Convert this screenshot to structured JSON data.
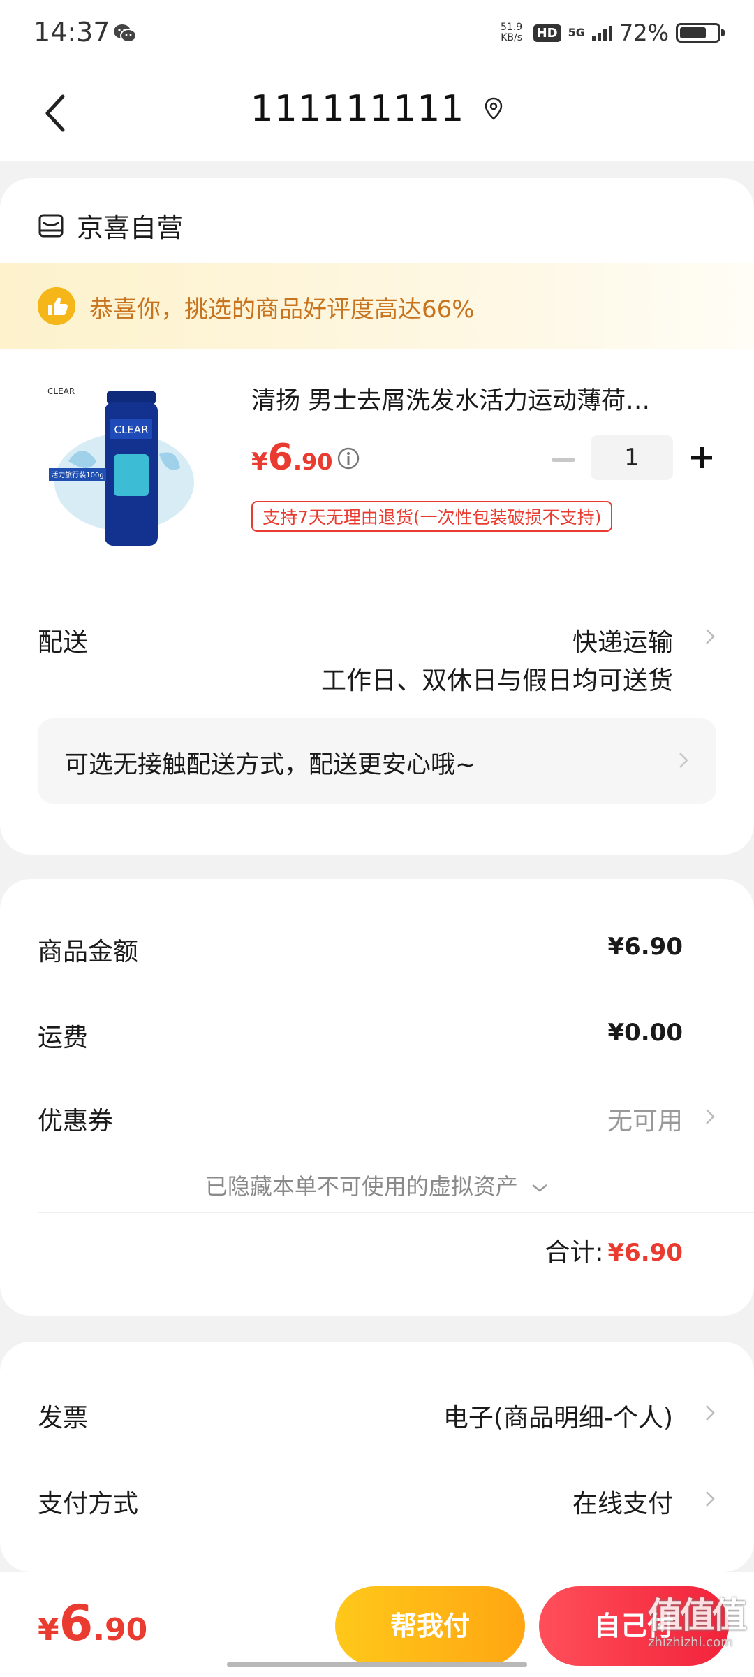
{
  "status_bar": {
    "time": "14:37",
    "net_speed_value": "51.9",
    "net_speed_unit": "KB/s",
    "hd": "HD",
    "network": "5G",
    "battery": "72%",
    "battery_level": 0.72
  },
  "nav": {
    "title": "111111111"
  },
  "order_card": {
    "shop_name": "京喜自营",
    "banner_text": "恭喜你，挑选的商品好评度高达66%",
    "product": {
      "title": "清扬 男士去屑洗发水活力运动薄荷…",
      "price_symbol": "¥",
      "price_int": "6",
      "price_dec": ".90",
      "quantity": "1",
      "return_policy": "支持7天无理由退货(一次性包装破损不支持)",
      "image_brand": "CLEAR",
      "image_text": "活力旅行装100g"
    },
    "shipping": {
      "label": "配送",
      "method": "快递运输",
      "note": "工作日、双休日与假日均可送货",
      "contactless": "可选无接触配送方式，配送更安心哦~"
    }
  },
  "summary": {
    "goods_label": "商品金额",
    "goods_value": "¥6.90",
    "freight_label": "运费",
    "freight_value": "¥0.00",
    "coupon_label": "优惠券",
    "coupon_value": "无可用",
    "hidden_assets": "已隐藏本单不可使用的虚拟资产",
    "total_label": "合计:",
    "total_value": "¥6.90"
  },
  "invoice_payment": {
    "invoice_label": "发票",
    "invoice_value": "电子(商品明细-个人)",
    "payment_label": "支付方式",
    "payment_value": "在线支付"
  },
  "bottom_bar": {
    "price_symbol": "¥",
    "price_int": "6",
    "price_dec": ".90",
    "help_pay": "帮我付",
    "self_pay": "自己付"
  },
  "watermark": {
    "site": "zhizhizhi.com"
  },
  "colors": {
    "accent_red": "#e93b2f",
    "banner_orange": "#c8731e",
    "btn_yellow": "#ffb614",
    "btn_red": "#f2223a"
  }
}
